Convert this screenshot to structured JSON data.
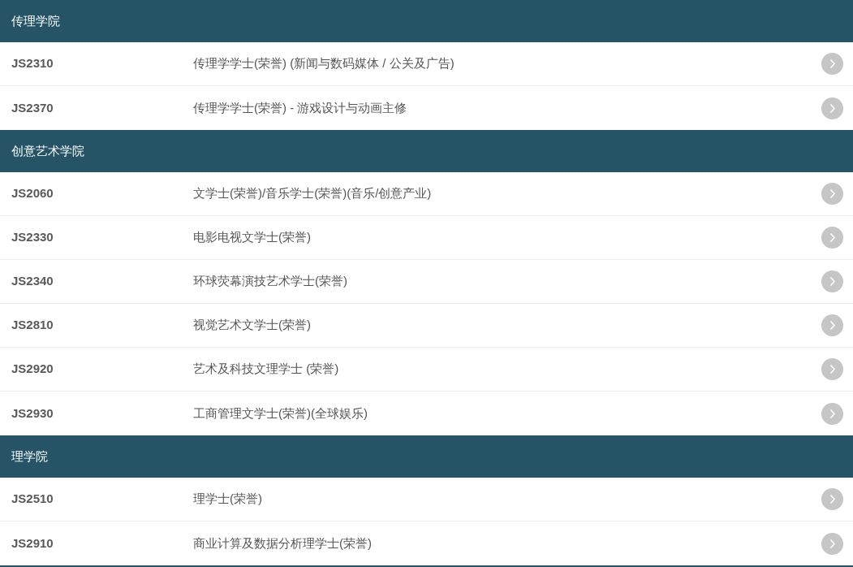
{
  "sections": [
    {
      "title": "传理学院",
      "programmes": [
        {
          "code": "JS2310",
          "name": "传理学学士(荣誉) (新闻与数码媒体 / 公关及广告)"
        },
        {
          "code": "JS2370",
          "name": "传理学学士(荣誉) - 游戏设计与动画主修"
        }
      ]
    },
    {
      "title": "创意艺术学院",
      "programmes": [
        {
          "code": "JS2060",
          "name": "文学士(荣誉)/音乐学士(荣誉)(音乐/创意产业)"
        },
        {
          "code": "JS2330",
          "name": "电影电视文学士(荣誉)"
        },
        {
          "code": "JS2340",
          "name": "环球荧幕演技艺术学士(荣誉)"
        },
        {
          "code": "JS2810",
          "name": "视觉艺术文学士(荣誉)"
        },
        {
          "code": "JS2920",
          "name": "艺术及科技文理学士 (荣誉)"
        },
        {
          "code": "JS2930",
          "name": "工商管理文学士(荣誉)(全球娱乐)"
        }
      ]
    },
    {
      "title": "理学院",
      "programmes": [
        {
          "code": "JS2510",
          "name": "理学士(荣誉)"
        },
        {
          "code": "JS2910",
          "name": "商业计算及数据分析理学士(荣誉)"
        }
      ]
    }
  ]
}
